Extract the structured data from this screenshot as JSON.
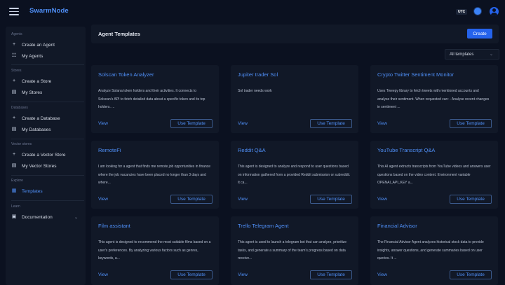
{
  "app": {
    "title": "SwarmNode",
    "utc_label": "UTC"
  },
  "sidebar": {
    "sections": [
      {
        "label": "Agents",
        "items": [
          {
            "label": "Create an Agent",
            "icon": "plus-icon"
          },
          {
            "label": "My Agents",
            "icon": "robot-icon"
          }
        ]
      },
      {
        "label": "Stores",
        "items": [
          {
            "label": "Create a Store",
            "icon": "plus-icon"
          },
          {
            "label": "My Stores",
            "icon": "database-icon"
          }
        ]
      },
      {
        "label": "Databases",
        "items": [
          {
            "label": "Create a Database",
            "icon": "plus-icon"
          },
          {
            "label": "My Databases",
            "icon": "database-icon"
          }
        ]
      },
      {
        "label": "Vector stores",
        "items": [
          {
            "label": "Create a Vector Store",
            "icon": "plus-icon"
          },
          {
            "label": "My Vector Stores",
            "icon": "database-icon"
          }
        ]
      },
      {
        "label": "Explore",
        "items": [
          {
            "label": "Templates",
            "icon": "template-icon",
            "active": true
          }
        ]
      },
      {
        "label": "Learn",
        "items": [
          {
            "label": "Documentation",
            "icon": "book-icon",
            "expandable": true
          }
        ]
      }
    ]
  },
  "header": {
    "title": "Agent Templates",
    "create_label": "Create"
  },
  "filter": {
    "selected": "All templates"
  },
  "card_actions": {
    "view_label": "View",
    "use_label": "Use Template"
  },
  "templates": [
    {
      "title": "Solscan Token Analyzer",
      "description": "Analyze Solana token holders and their activities. It connects to Solscan's API to fetch detailed data about a specific token and its top holders. ..."
    },
    {
      "title": "Jupiter trader Sol",
      "description": "Sol trader needs work"
    },
    {
      "title": "Crypto Twitter Sentiment Monitor",
      "description": "Uses Tweepy library to fetch tweets with mentioned accounts and analyse their sentiment. When requested can: - Analyse recent changes in sentiment ..."
    },
    {
      "title": "RemoteFi",
      "description": "I am looking for a agent that finds me remote job opportunities in finance where the job vacancies have been placed no longer than 3 days and where..."
    },
    {
      "title": "Reddit Q&A",
      "description": "This agent is designed to analyze and respond to user questions based on information gathered from a provided Reddit submission or subreddit. It ca..."
    },
    {
      "title": "YouTube Transcript Q&A",
      "description": "This AI agent extracts transcripts from YouTube videos and answers user questions based on the video content. Environment variable OPENAI_API_KEY a..."
    },
    {
      "title": "Film assistant",
      "description": "This agent is designed to recommend the most suitable films based on a user's preferences. By analyzing various factors such as genres, keywords, a..."
    },
    {
      "title": "Trello Telegram Agent",
      "description": "This agent is used to launch a telegram bot that can analyze, prioritize tasks, and generate a summary of the team's progress based on data receive..."
    },
    {
      "title": "Financial Advisor",
      "description": "The Financial Advisor Agent analyzes historical stock data to provide insights, answer questions, and generate summaries based on user queries. It ..."
    }
  ],
  "colors": {
    "accent": "#4f8ff7",
    "primary_button": "#2563eb",
    "background": "#0b1120",
    "card": "#111827"
  }
}
